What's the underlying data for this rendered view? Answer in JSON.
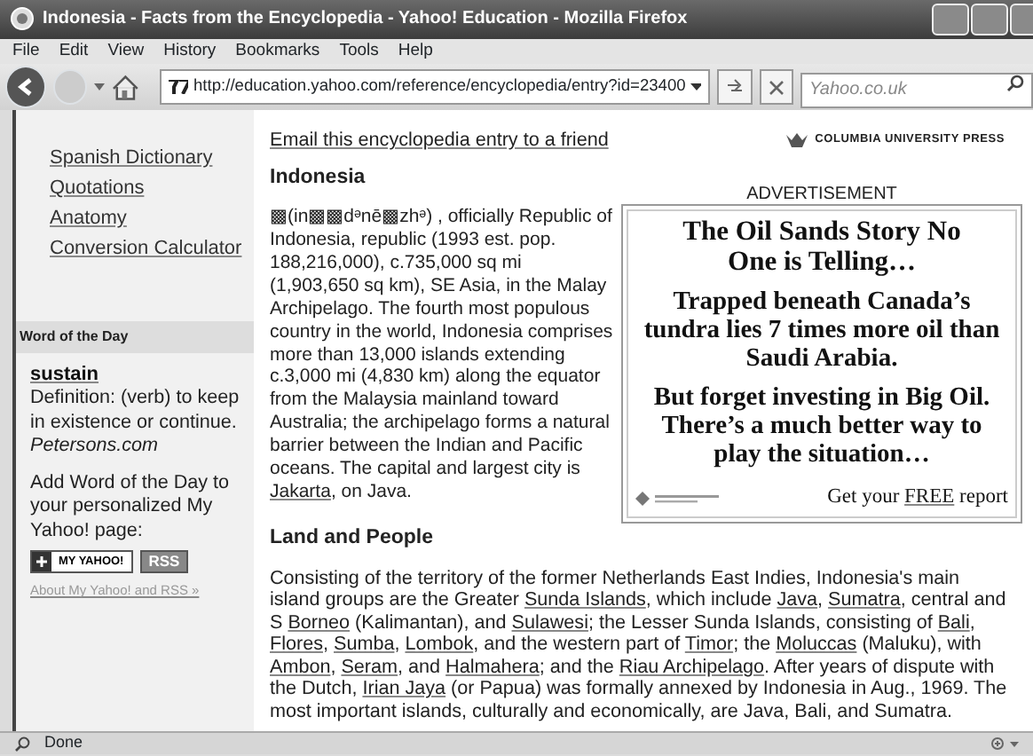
{
  "window": {
    "title": "Indonesia - Facts from the Encyclopedia - Yahoo! Education - Mozilla Firefox"
  },
  "menu": [
    "File",
    "Edit",
    "View",
    "History",
    "Bookmarks",
    "Tools",
    "Help"
  ],
  "address_bar": {
    "url": "http://education.yahoo.com/reference/encyclopedia/entry?id=23400"
  },
  "search": {
    "placeholder": "Yahoo.co.uk"
  },
  "sidebar": {
    "links": [
      "Spanish Dictionary",
      "Quotations",
      "Anatomy",
      "Conversion Calculator"
    ],
    "word_of_the_day": {
      "heading": "Word of the Day",
      "word": "sustain",
      "definition": "Definition: (verb) to keep in existence or continue.",
      "source": "Petersons.com",
      "add_text": "Add Word of the Day to your personalized My Yahoo! page:",
      "my_yahoo_button": "MY YAHOO!",
      "rss_button": "RSS",
      "about_link": "About My Yahoo! and RSS »"
    }
  },
  "article": {
    "email_link": "Email this encyclopedia entry to a friend",
    "publisher": "COLUMBIA UNIVERSITY PRESS",
    "title": "Indonesia",
    "intro": [
      {
        "text": "▩(in▩▩dᵊnē▩zhᵊ) , officially Republic of Indonesia, republic (1993 est. pop. 188,216,000), c.735,000 sq mi (1,903,650 sq km), SE Asia, in the Malay Archipelago. The fourth most populous country in the world, Indonesia comprises more than 13,000 islands extending c.3,000 mi (4,830 km) along the equator from the Malaysia mainland toward Australia; the archipelago forms a natural barrier between the Indian and Pacific oceans. The capital and largest city is ",
        "link": false
      },
      {
        "text": "Jakarta",
        "link": true
      },
      {
        "text": ", on Java.",
        "link": false
      }
    ],
    "section_heading": "Land and People",
    "section_text": [
      {
        "text": "Consisting of the territory of the former Netherlands East Indies, Indonesia's main island groups are the Greater ",
        "link": false
      },
      {
        "text": "Sunda Islands",
        "link": true
      },
      {
        "text": ", which include ",
        "link": false
      },
      {
        "text": "Java",
        "link": true
      },
      {
        "text": ", ",
        "link": false
      },
      {
        "text": "Sumatra",
        "link": true
      },
      {
        "text": ", central and S ",
        "link": false
      },
      {
        "text": "Borneo",
        "link": true
      },
      {
        "text": " (Kalimantan), and ",
        "link": false
      },
      {
        "text": "Sulawesi",
        "link": true
      },
      {
        "text": "; the Lesser Sunda Islands, consisting of ",
        "link": false
      },
      {
        "text": "Bali",
        "link": true
      },
      {
        "text": ", ",
        "link": false
      },
      {
        "text": "Flores",
        "link": true
      },
      {
        "text": ", ",
        "link": false
      },
      {
        "text": "Sumba",
        "link": true
      },
      {
        "text": ", ",
        "link": false
      },
      {
        "text": "Lombok",
        "link": true
      },
      {
        "text": ", and the western part of ",
        "link": false
      },
      {
        "text": "Timor",
        "link": true
      },
      {
        "text": "; the ",
        "link": false
      },
      {
        "text": "Moluccas",
        "link": true
      },
      {
        "text": " (Maluku), with ",
        "link": false
      },
      {
        "text": "Ambon",
        "link": true
      },
      {
        "text": ", ",
        "link": false
      },
      {
        "text": "Seram",
        "link": true
      },
      {
        "text": ", and ",
        "link": false
      },
      {
        "text": "Halmahera",
        "link": true
      },
      {
        "text": "; and the ",
        "link": false
      },
      {
        "text": "Riau Archipelago",
        "link": true
      },
      {
        "text": ". After years of dispute with the Dutch, ",
        "link": false
      },
      {
        "text": "Irian Jaya",
        "link": true
      },
      {
        "text": " (or Papua) was formally annexed by Indonesia in Aug., 1969. The most important islands, culturally and economically, are Java, Bali, and Sumatra.",
        "link": false
      }
    ]
  },
  "advertisement": {
    "label": "ADVERTISEMENT",
    "headline": "The Oil Sands Story No One is Telling…",
    "body": [
      "Trapped beneath Canada’s tundra lies 7 times more oil than Saudi Arabia.",
      "But forget investing in Big Oil. There’s a much better way to play the situation…"
    ],
    "cta": [
      {
        "text": "Get your ",
        "link": false
      },
      {
        "text": "FREE",
        "link": true
      },
      {
        "text": " report",
        "link": false
      }
    ]
  },
  "status_bar": {
    "text": "Done"
  }
}
